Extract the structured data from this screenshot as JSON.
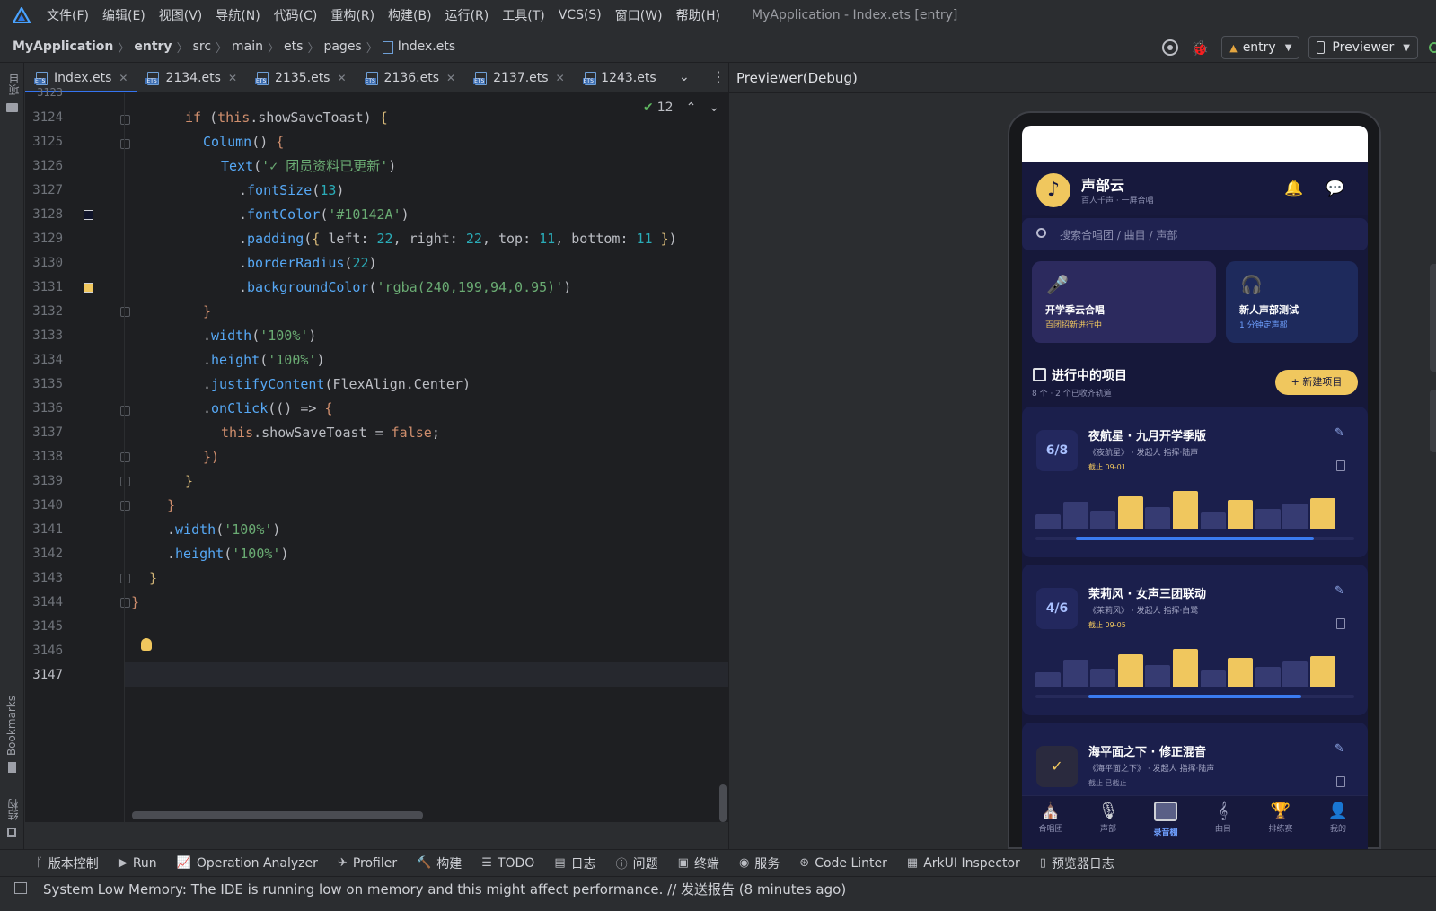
{
  "menubar": {
    "items": [
      "文件(F)",
      "编辑(E)",
      "视图(V)",
      "导航(N)",
      "代码(C)",
      "重构(R)",
      "构建(B)",
      "运行(R)",
      "工具(T)",
      "VCS(S)",
      "窗口(W)",
      "帮助(H)"
    ],
    "window_title": "MyApplication - Index.ets [entry]"
  },
  "breadcrumb": {
    "items": [
      "MyApplication",
      "entry",
      "src",
      "main",
      "ets",
      "pages",
      "Index.ets"
    ]
  },
  "run_config": {
    "module": "entry",
    "device": "Previewer"
  },
  "left_strip": {
    "project": "项目",
    "bookmarks": "Bookmarks",
    "structure": "结构"
  },
  "tabs": [
    {
      "label": "Index.ets",
      "active": true
    },
    {
      "label": "2134.ets"
    },
    {
      "label": "2135.ets"
    },
    {
      "label": "2136.ets"
    },
    {
      "label": "2137.ets"
    },
    {
      "label": "1243.ets"
    }
  ],
  "editor": {
    "inspection_count": "12",
    "top_partial_line": "3123",
    "line_numbers": [
      "3124",
      "3125",
      "3126",
      "3127",
      "3128",
      "3129",
      "3130",
      "3131",
      "3132",
      "3133",
      "3134",
      "3135",
      "3136",
      "3137",
      "3138",
      "3139",
      "3140",
      "3141",
      "3142",
      "3143",
      "3144",
      "3145",
      "3146",
      "3147"
    ],
    "color_swatches": {
      "line_3128": "#10142A",
      "line_3131": "#F0C75E"
    }
  },
  "previewer": {
    "title": "Previewer(Debug)"
  },
  "app": {
    "name": "声部云",
    "slogan": "百人千声 · 一屏合唱",
    "search_placeholder": "搜索合唱团 / 曲目 / 声部",
    "banner1": {
      "title": "开学季云合唱",
      "sub": "百团招新进行中"
    },
    "banner2": {
      "title": "新人声部测试",
      "sub": "1 分钟定声部"
    },
    "section_title": "进行中的项目",
    "section_sub": "8 个 · 2 个已收齐轨道",
    "new_button": "+ 新建项目",
    "projects": [
      {
        "progress": "6/8",
        "title": "夜航星 · 九月开学季版",
        "meta": "《夜航星》 · 发起人 指挥·陆声",
        "deadline": "截止 09-01",
        "fill": 0.75
      },
      {
        "progress": "4/6",
        "title": "茉莉风 · 女声三团联动",
        "meta": "《茉莉风》 · 发起人 指挥·白鹭",
        "deadline": "截止 09-05",
        "fill": 0.67
      },
      {
        "progress": "✓",
        "title": "海平面之下 · 修正混音",
        "meta": "《海平面之下》 · 发起人 指挥·陆声",
        "deadline": "截止 已截止",
        "fill": 1.0
      }
    ],
    "tabbar": [
      "合唱团",
      "声部",
      "录音棚",
      "曲目",
      "排练赛",
      "我的"
    ],
    "active_tab": "录音棚",
    "colors": {
      "bg": "#16183a",
      "accent": "#f0c75e",
      "progress": "#3a7bf0"
    }
  },
  "toolwindows": [
    "版本控制",
    "Run",
    "Operation Analyzer",
    "Profiler",
    "构建",
    "TODO",
    "日志",
    "问题",
    "终端",
    "服务",
    "Code Linter",
    "ArkUI Inspector",
    "预览器日志"
  ],
  "status": {
    "message": "System Low Memory: The IDE is running low on memory and this might affect performance. // 发送报告 (8 minutes ago)"
  }
}
